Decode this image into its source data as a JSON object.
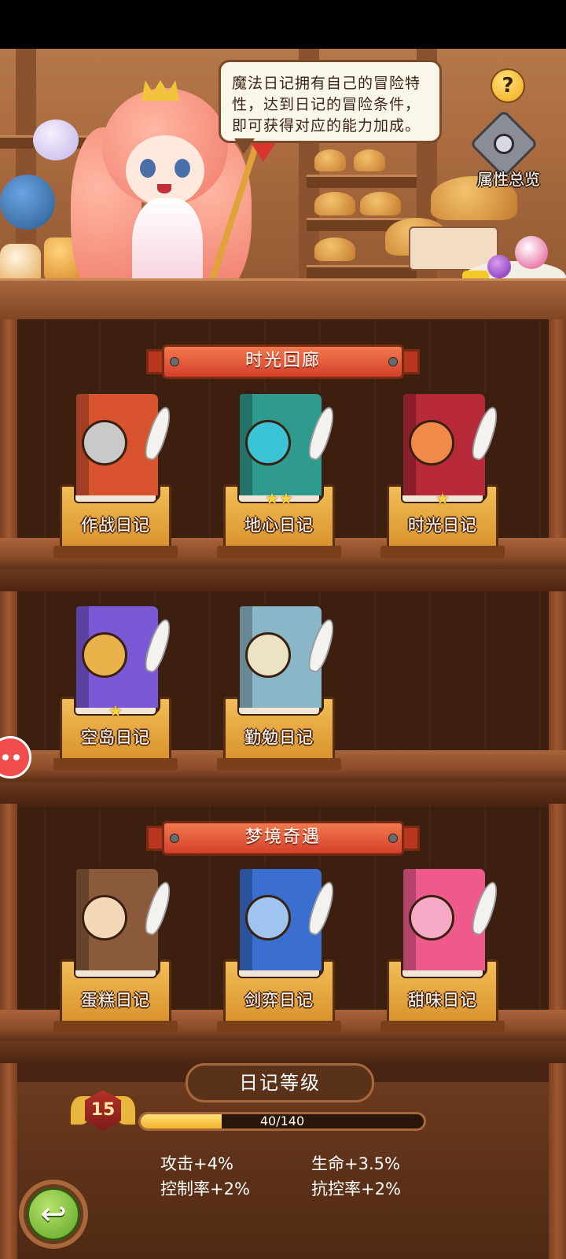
{
  "header": {
    "dialogue": "魔法日记拥有自己的冒险特性，达到日记的冒险条件，即可获得对应的能力加成。",
    "dialogue_lines": [
      "魔法日记拥有自己的冒险特",
      "性，达到日记的冒险条件，",
      "即可获得对应的能力加成。"
    ],
    "help_label": "?",
    "overview_label": "属性总览"
  },
  "sections": [
    {
      "title": "时光回廊",
      "books": [
        {
          "name": "作战日记",
          "stars": "",
          "color": "#d9532e",
          "emblem": "#c9c9c9",
          "icon": "crossed-swords-icon"
        },
        {
          "name": "地心日记",
          "stars": "★★",
          "color": "#2f9a8e",
          "emblem": "#3ac4d6",
          "icon": "earth-rune-icon"
        },
        {
          "name": "时光日记",
          "stars": "★",
          "color": "#b82a3a",
          "emblem": "#f08a4a",
          "icon": "shield-gem-icon"
        }
      ]
    },
    {
      "title": "",
      "books": [
        {
          "name": "空岛日记",
          "stars": "★",
          "color": "#7b59d6",
          "emblem": "#e9b24a",
          "icon": "compass-icon"
        },
        {
          "name": "勤勉日记",
          "stars": "",
          "color": "#8ab7c7",
          "emblem": "#ece2c4",
          "icon": "cross-emblem-icon"
        }
      ]
    },
    {
      "title": "梦境奇遇",
      "books": [
        {
          "name": "蛋糕日记",
          "stars": "",
          "color": "#8a5a3a",
          "emblem": "#f4d9b8",
          "icon": "cake-icon"
        },
        {
          "name": "剑弈日记",
          "stars": "",
          "color": "#3a6fd0",
          "emblem": "#9ec4ef",
          "icon": "crossed-blades-icon"
        },
        {
          "name": "甜味日记",
          "stars": "",
          "color": "#ef5a8d",
          "emblem": "#f7a9c8",
          "icon": "donut-icon"
        }
      ]
    }
  ],
  "diary_level": {
    "title": "日记等级",
    "level": "15",
    "progress_text": "40/140",
    "progress": 0.2857,
    "stats": [
      {
        "label": "攻击+4%"
      },
      {
        "label": "生命+3.5%"
      },
      {
        "label": "控制率+2%"
      },
      {
        "label": "抗控率+2%"
      }
    ]
  },
  "back_glyph": "↩"
}
